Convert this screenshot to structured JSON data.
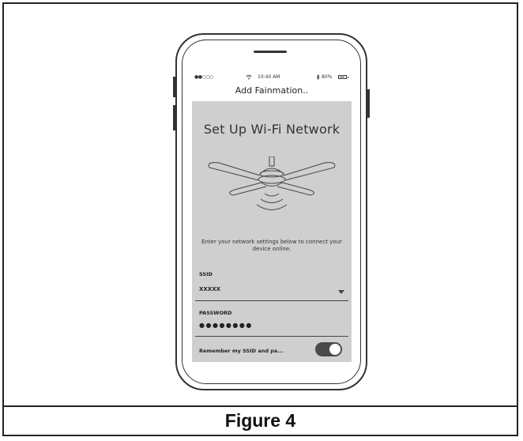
{
  "status_bar": {
    "signal": "●●○○○",
    "time": "10:40 AM",
    "battery": "80%"
  },
  "nav": {
    "title": "Add Fainmation.."
  },
  "screen": {
    "heading": "Set Up Wi-Fi Network",
    "instructions": "Enter your network settings below to connect your device online.",
    "ssid_label": "SSID",
    "ssid_value": "XXXXX",
    "password_label": "PASSWORD",
    "password_value": "●●●●●●●●",
    "remember_label": "Remember my SSID and pa...",
    "remember_on": true
  },
  "figure": {
    "caption": "Figure 4"
  },
  "icons": [
    "wifi-icon",
    "bluetooth-icon",
    "battery-icon",
    "ceiling-fan-icon",
    "dropdown-caret-icon"
  ]
}
